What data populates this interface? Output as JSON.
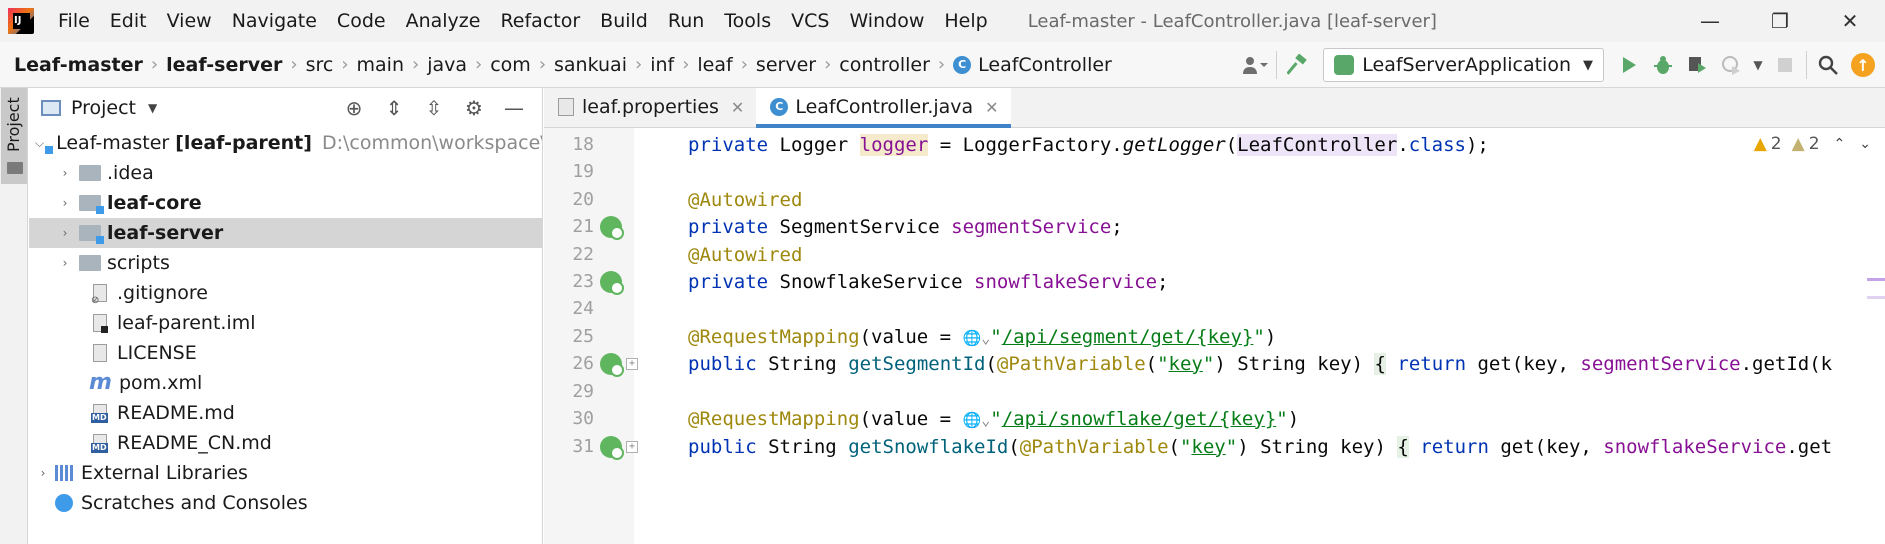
{
  "menu": {
    "items": [
      {
        "label": "File"
      },
      {
        "label": "Edit"
      },
      {
        "label": "View"
      },
      {
        "label": "Navigate"
      },
      {
        "label": "Code"
      },
      {
        "label": "Analyze"
      },
      {
        "label": "Refactor"
      },
      {
        "label": "Build"
      },
      {
        "label": "Run"
      },
      {
        "label": "Tools"
      },
      {
        "label": "VCS"
      },
      {
        "label": "Window"
      },
      {
        "label": "Help"
      }
    ],
    "window_title": "Leaf-master - LeafController.java [leaf-server]"
  },
  "window_controls": {
    "minimize": "—",
    "restore": "❐",
    "close": "✕"
  },
  "breadcrumbs": [
    {
      "label": "Leaf-master"
    },
    {
      "label": "leaf-server"
    },
    {
      "label": "src"
    },
    {
      "label": "main"
    },
    {
      "label": "java"
    },
    {
      "label": "com"
    },
    {
      "label": "sankuai"
    },
    {
      "label": "inf"
    },
    {
      "label": "leaf"
    },
    {
      "label": "server"
    },
    {
      "label": "controller"
    },
    {
      "label": "LeafController"
    }
  ],
  "toolbar": {
    "run_config": "LeafServerApplication",
    "update_badge": "↑",
    "icons": [
      "user-icon",
      "hammer-icon",
      "run-icon",
      "debug-icon",
      "coverage-icon",
      "profile-icon",
      "stop-icon",
      "search-icon"
    ]
  },
  "tool_strip": {
    "project_tab": "Project"
  },
  "project_panel": {
    "title": "Project",
    "tree": [
      {
        "label": "Leaf-master",
        "suffix": "[leaf-parent]",
        "hint": "D:\\common\\workspace\\lr"
      },
      {
        "label": ".idea"
      },
      {
        "label": "leaf-core"
      },
      {
        "label": "leaf-server"
      },
      {
        "label": "scripts"
      },
      {
        "label": ".gitignore"
      },
      {
        "label": "leaf-parent.iml"
      },
      {
        "label": "LICENSE"
      },
      {
        "label": "pom.xml"
      },
      {
        "label": "README.md"
      },
      {
        "label": "README_CN.md"
      },
      {
        "label": "External Libraries"
      },
      {
        "label": "Scratches and Consoles"
      }
    ]
  },
  "editor": {
    "tabs": [
      {
        "label": "leaf.properties"
      },
      {
        "label": "LeafController.java"
      }
    ],
    "inspections": {
      "warnings": "2",
      "weak_warnings": "2"
    },
    "lines": [
      {
        "num": "18"
      },
      {
        "num": "19"
      },
      {
        "num": "20"
      },
      {
        "num": "21"
      },
      {
        "num": "22"
      },
      {
        "num": "23"
      },
      {
        "num": "24"
      },
      {
        "num": "25"
      },
      {
        "num": "26"
      },
      {
        "num": "29"
      },
      {
        "num": "30"
      },
      {
        "num": "31"
      }
    ],
    "code": {
      "kw_private": "private",
      "kw_public": "public",
      "kw_return": "return",
      "kw_class": "class",
      "type_logger": "Logger",
      "fld_logger": "logger",
      "logger_factory": "LoggerFactory.",
      "get_logger": "getLogger",
      "leaf_controller": "LeafController",
      "ann_autowired": "@Autowired",
      "type_segment_service": "SegmentService",
      "fld_segment_service": "segmentService",
      "type_snowflake_service": "SnowflakeService",
      "fld_snowflake_service": "snowflakeService",
      "ann_request_mapping": "@RequestMapping",
      "value_eq": "(value = ",
      "path_segment": "/api/segment/get/{key}",
      "path_snowflake": "/api/snowflake/get/{key}",
      "type_string": "String",
      "m_get_segment_id": "getSegmentId",
      "m_get_snowflake_id": "getSnowflakeId",
      "ann_path_variable": "@PathVariable",
      "str_key": "key",
      "param_rest": ") String key) ",
      "get_call": " get(key, ",
      "get_id_tail": ".getId(k",
      "get_tail": ".get"
    }
  }
}
